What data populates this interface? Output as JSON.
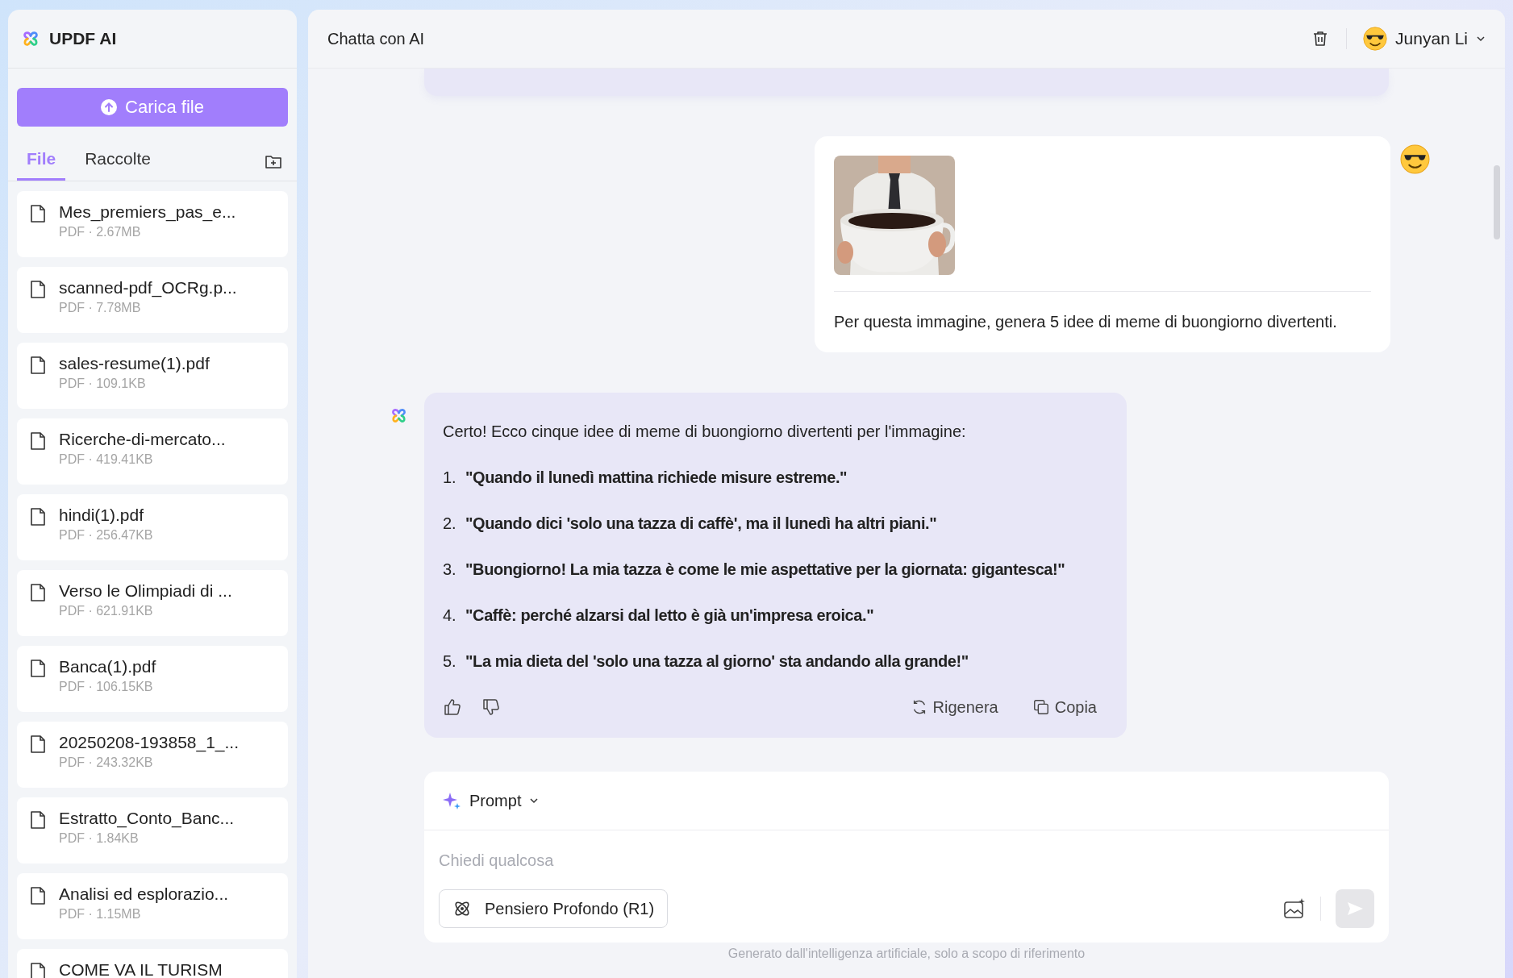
{
  "app": {
    "name": "UPDF AI"
  },
  "upload_button": "Carica file",
  "tabs": [
    {
      "label": "File",
      "selected": true
    },
    {
      "label": "Raccolte",
      "selected": false
    }
  ],
  "files": [
    {
      "name": "Mes_premiers_pas_e...",
      "meta": "PDF · 2.67MB"
    },
    {
      "name": "scanned-pdf_OCRg.p...",
      "meta": "PDF · 7.78MB"
    },
    {
      "name": "sales-resume(1).pdf",
      "meta": "PDF · 109.1KB"
    },
    {
      "name": "Ricerche-di-mercato...",
      "meta": "PDF · 419.41KB"
    },
    {
      "name": "hindi(1).pdf",
      "meta": "PDF · 256.47KB"
    },
    {
      "name": "Verso le Olimpiadi di ...",
      "meta": "PDF · 621.91KB"
    },
    {
      "name": "Banca(1).pdf",
      "meta": "PDF · 106.15KB"
    },
    {
      "name": "20250208-193858_1_...",
      "meta": "PDF · 243.32KB"
    },
    {
      "name": "Estratto_Conto_Banc...",
      "meta": "PDF · 1.84KB"
    },
    {
      "name": "Analisi ed esplorazio...",
      "meta": "PDF · 1.15MB"
    },
    {
      "name": "COME VA IL TURISM"
    }
  ],
  "header": {
    "title": "Chatta con AI",
    "user": "Junyan Li"
  },
  "messages": [
    {
      "kind": "cut_off"
    },
    {
      "kind": "user",
      "text": "Per questa immagine, genera 5 idee di meme di buongiorno divertenti."
    },
    {
      "kind": "assistant",
      "intro": "Certo! Ecco cinque idee di meme di buongiorno divertenti per l'immagine:",
      "items": [
        {
          "number": "1.",
          "text": "\"Quando il lunedì mattina richiede misure estreme.\""
        },
        {
          "number": "2.",
          "text": "\"Quando dici 'solo una tazza di caffè', ma il lunedì ha altri piani.\""
        },
        {
          "number": "3.",
          "text": "\"Buongiorno! La mia tazza è come le mie aspettative per la giornata: gigantesca!\""
        },
        {
          "number": "4.",
          "text": "\"Caffè: perché alzarsi dal letto è già un'impresa eroica.\""
        },
        {
          "number": "5.",
          "text": "\"La mia dieta del 'solo una tazza al giorno' sta andando alla grande!\""
        }
      ],
      "actions": [
        "Rigenera",
        "Copia"
      ]
    }
  ],
  "composer": {
    "mode": "Prompt",
    "placeholder": "Chiedi qualcosa",
    "deep_think": "Pensiero Profondo (R1)"
  },
  "disclaimer": "Generato dall'intelligenza artificiale, solo a scopo di riferimento"
}
